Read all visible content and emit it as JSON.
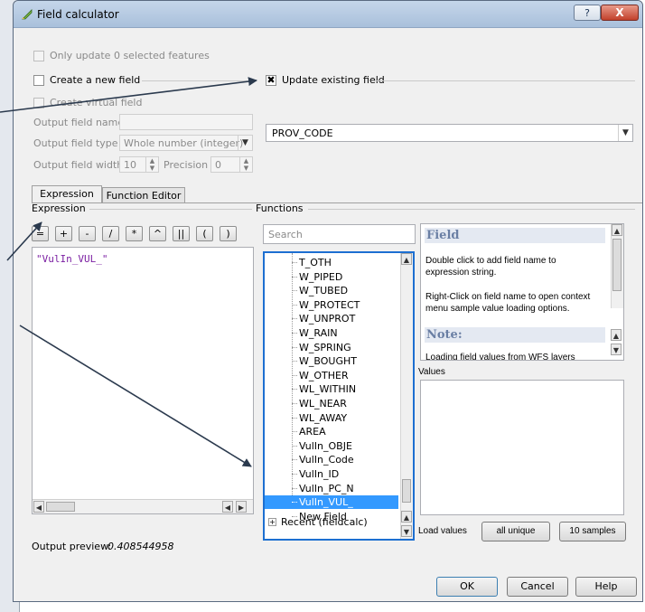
{
  "window": {
    "title": "Field calculator",
    "help_glyph": "?",
    "close_glyph": "X"
  },
  "top": {
    "only_update_label": "Only update 0 selected features",
    "create_new_label": "Create a new field",
    "update_existing_label": "Update existing field",
    "create_virtual_label": "Create virtual field",
    "output_name_label": "Output field name",
    "output_type_label": "Output field type",
    "output_type_value": "Whole number (integer)",
    "output_width_label": "Output field width",
    "output_width_value": "10",
    "precision_label": "Precision",
    "precision_value": "0",
    "existing_field_value": "PROV_CODE"
  },
  "tabs": [
    "Expression",
    "Function Editor"
  ],
  "expression": {
    "group_label": "Expression",
    "operators": [
      "=",
      "+",
      "-",
      "/",
      "*",
      "^",
      "||",
      "(",
      ")"
    ],
    "text": "\"VulIn_VUL_\"",
    "preview_label": "Output preview:",
    "preview_value": "0.408544958"
  },
  "functions": {
    "group_label": "Functions",
    "search_placeholder": "Search",
    "items": [
      "T_OTH",
      "W_PIPED",
      "W_TUBED",
      "W_PROTECT",
      "W_UNPROT",
      "W_RAIN",
      "W_SPRING",
      "W_BOUGHT",
      "W_OTHER",
      "WL_WITHIN",
      "WL_NEAR",
      "WL_AWAY",
      "AREA",
      "VulIn_OBJE",
      "VulIn_Code",
      "VulIn_ID",
      "VulIn_PC_N",
      "VulIn_VUL_",
      "New Field"
    ],
    "selected": "VulIn_VUL_",
    "recent_label": "Recent (fieldcalc)",
    "recent_expander": "+"
  },
  "help": {
    "title": "Field",
    "p1": "Double click to add field name to expression string.",
    "p2": "Right-Click on field name to open context menu sample value loading options.",
    "note_title": "Note:",
    "note_text": "Loading field values from WFS layers"
  },
  "values": {
    "label": "Values",
    "load_label": "Load values",
    "all_unique": "all unique",
    "samples": "10 samples"
  },
  "buttons": {
    "ok": "OK",
    "cancel": "Cancel",
    "help": "Help"
  },
  "colors": {
    "selection": "#3399ff",
    "expression_text": "#7b1fa2",
    "arrow": "#2b3a4e"
  }
}
